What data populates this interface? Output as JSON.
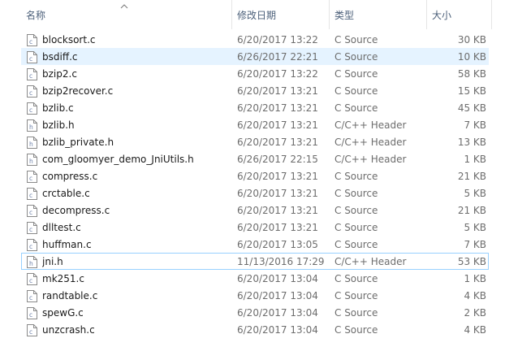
{
  "columns": {
    "name": "名称",
    "date": "修改日期",
    "type": "类型",
    "size": "大小",
    "sort_indicator_icon": "chevron-up-icon"
  },
  "files": [
    {
      "name": "blocksort.c",
      "date": "6/20/2017 13:22",
      "type": "C Source",
      "size": "30 KB",
      "icon": "c-source-file-icon"
    },
    {
      "name": "bsdiff.c",
      "date": "6/26/2017 22:21",
      "type": "C Source",
      "size": "10 KB",
      "icon": "c-source-file-icon",
      "state": "hover"
    },
    {
      "name": "bzip2.c",
      "date": "6/20/2017 13:22",
      "type": "C Source",
      "size": "58 KB",
      "icon": "c-source-file-icon"
    },
    {
      "name": "bzip2recover.c",
      "date": "6/20/2017 13:21",
      "type": "C Source",
      "size": "15 KB",
      "icon": "c-source-file-icon"
    },
    {
      "name": "bzlib.c",
      "date": "6/20/2017 13:21",
      "type": "C Source",
      "size": "45 KB",
      "icon": "c-source-file-icon"
    },
    {
      "name": "bzlib.h",
      "date": "6/20/2017 13:21",
      "type": "C/C++ Header",
      "size": "7 KB",
      "icon": "header-file-icon"
    },
    {
      "name": "bzlib_private.h",
      "date": "6/20/2017 13:21",
      "type": "C/C++ Header",
      "size": "13 KB",
      "icon": "header-file-icon"
    },
    {
      "name": "com_gloomyer_demo_JniUtils.h",
      "date": "6/26/2017 22:15",
      "type": "C/C++ Header",
      "size": "1 KB",
      "icon": "header-file-icon"
    },
    {
      "name": "compress.c",
      "date": "6/20/2017 13:21",
      "type": "C Source",
      "size": "21 KB",
      "icon": "c-source-file-icon"
    },
    {
      "name": "crctable.c",
      "date": "6/20/2017 13:21",
      "type": "C Source",
      "size": "5 KB",
      "icon": "c-source-file-icon"
    },
    {
      "name": "decompress.c",
      "date": "6/20/2017 13:21",
      "type": "C Source",
      "size": "21 KB",
      "icon": "c-source-file-icon"
    },
    {
      "name": "dlltest.c",
      "date": "6/20/2017 13:21",
      "type": "C Source",
      "size": "5 KB",
      "icon": "c-source-file-icon"
    },
    {
      "name": "huffman.c",
      "date": "6/20/2017 13:05",
      "type": "C Source",
      "size": "7 KB",
      "icon": "c-source-file-icon"
    },
    {
      "name": "jni.h",
      "date": "11/13/2016 17:29",
      "type": "C/C++ Header",
      "size": "53 KB",
      "icon": "header-file-icon",
      "state": "selected"
    },
    {
      "name": "mk251.c",
      "date": "6/20/2017 13:04",
      "type": "C Source",
      "size": "1 KB",
      "icon": "c-source-file-icon"
    },
    {
      "name": "randtable.c",
      "date": "6/20/2017 13:04",
      "type": "C Source",
      "size": "4 KB",
      "icon": "c-source-file-icon"
    },
    {
      "name": "spewG.c",
      "date": "6/20/2017 13:04",
      "type": "C Source",
      "size": "2 KB",
      "icon": "c-source-file-icon"
    },
    {
      "name": "unzcrash.c",
      "date": "6/20/2017 13:04",
      "type": "C Source",
      "size": "4 KB",
      "icon": "c-source-file-icon"
    }
  ],
  "colors": {
    "header_text": "#4c607a",
    "hover_bg": "#e5f3ff",
    "selected_border": "#99d1ff",
    "icon_letter": "#6b7fa8"
  }
}
